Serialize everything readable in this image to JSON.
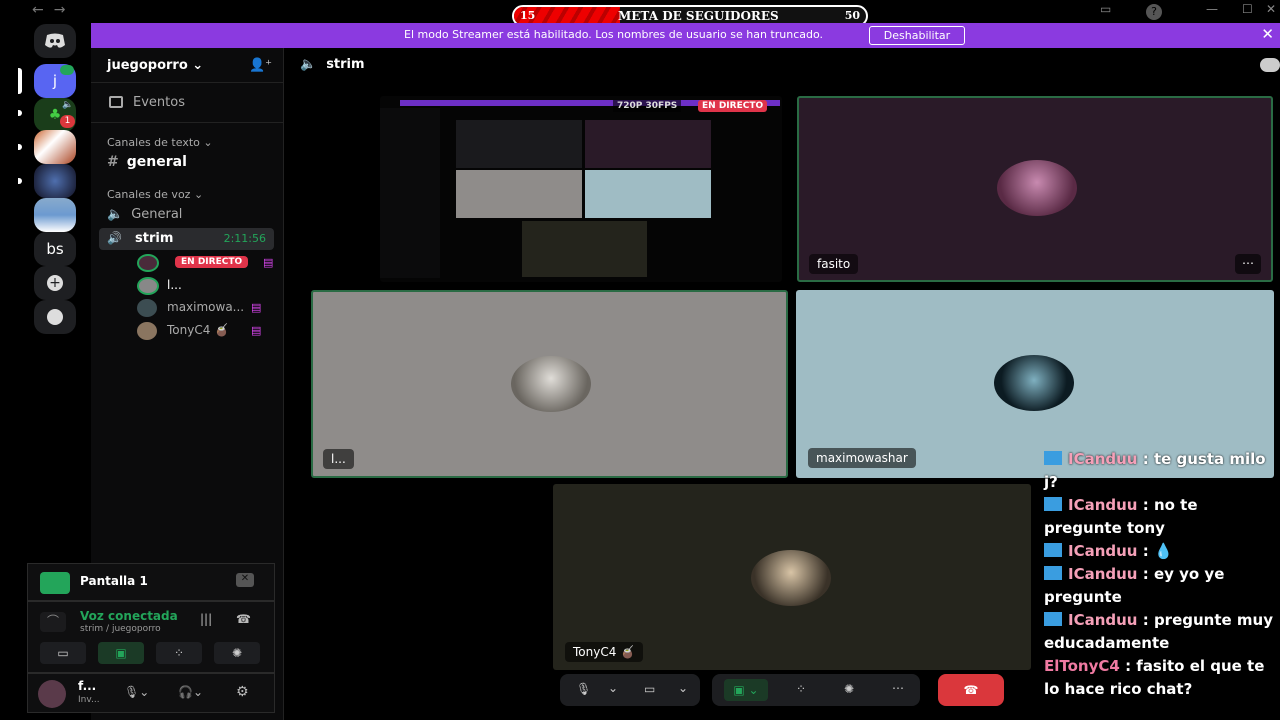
{
  "nav": {
    "back": "←",
    "forward": "→"
  },
  "goal": {
    "current": "15",
    "title": "META DE SEGUIDORES",
    "target": "50",
    "progress_fraction": 0.3
  },
  "banner": {
    "message": "El modo Streamer está habilitado. Los nombres de usuario se han truncado.",
    "button": "Deshabilitar"
  },
  "guilds": {
    "letter_server": "j",
    "text_server": "bs",
    "badge": "1"
  },
  "server": {
    "name": "juegoporro",
    "events": "Eventos"
  },
  "categories": {
    "text": "Canales de texto",
    "voice": "Canales de voz"
  },
  "channels": {
    "general_text": "general",
    "general_voice": "General",
    "strim": "strim",
    "strim_time": "2:11:56"
  },
  "voice_users": [
    {
      "name": "",
      "live": "EN DIRECTO"
    },
    {
      "name": "l..."
    },
    {
      "name": "maximowa..."
    },
    {
      "name": "TonyC4 🧉"
    }
  ],
  "panel": {
    "screen": "Pantalla 1",
    "status": "Voz conectada",
    "location": "strim / juegoporro",
    "user_name": "f...",
    "user_status": "Inv..."
  },
  "header": {
    "channel": "strim"
  },
  "tiles": {
    "stream_user": "fasito",
    "stream_quality": "720P 30FPS",
    "stream_live": "EN DIRECTO",
    "cam_fasito": "fasito",
    "cam_l": "l...",
    "cam_maximo": "maximowashar",
    "cam_tony": "TonyC4 🧉"
  },
  "chat": [
    {
      "user": "ICanduu",
      "text": " : te gusta milo j?",
      "class": "u1"
    },
    {
      "user": "ICanduu",
      "text": " : no te pregunte tony",
      "class": "u1"
    },
    {
      "user": "ICanduu",
      "text": " :  💧",
      "class": "u1"
    },
    {
      "user": "ICanduu",
      "text": " : ey yo ye pregunte",
      "class": "u1"
    },
    {
      "user": "ICanduu",
      "text": " : pregunte muy educadamente",
      "class": "u1"
    },
    {
      "user": "ElTonyC4",
      "text": " : fasito el que te lo hace rico chat?",
      "class": "u2"
    }
  ],
  "colors": {
    "accent": "#8b3ae0",
    "green": "#23a55a",
    "live_red": "#e0344a",
    "hangup": "#da373c"
  }
}
